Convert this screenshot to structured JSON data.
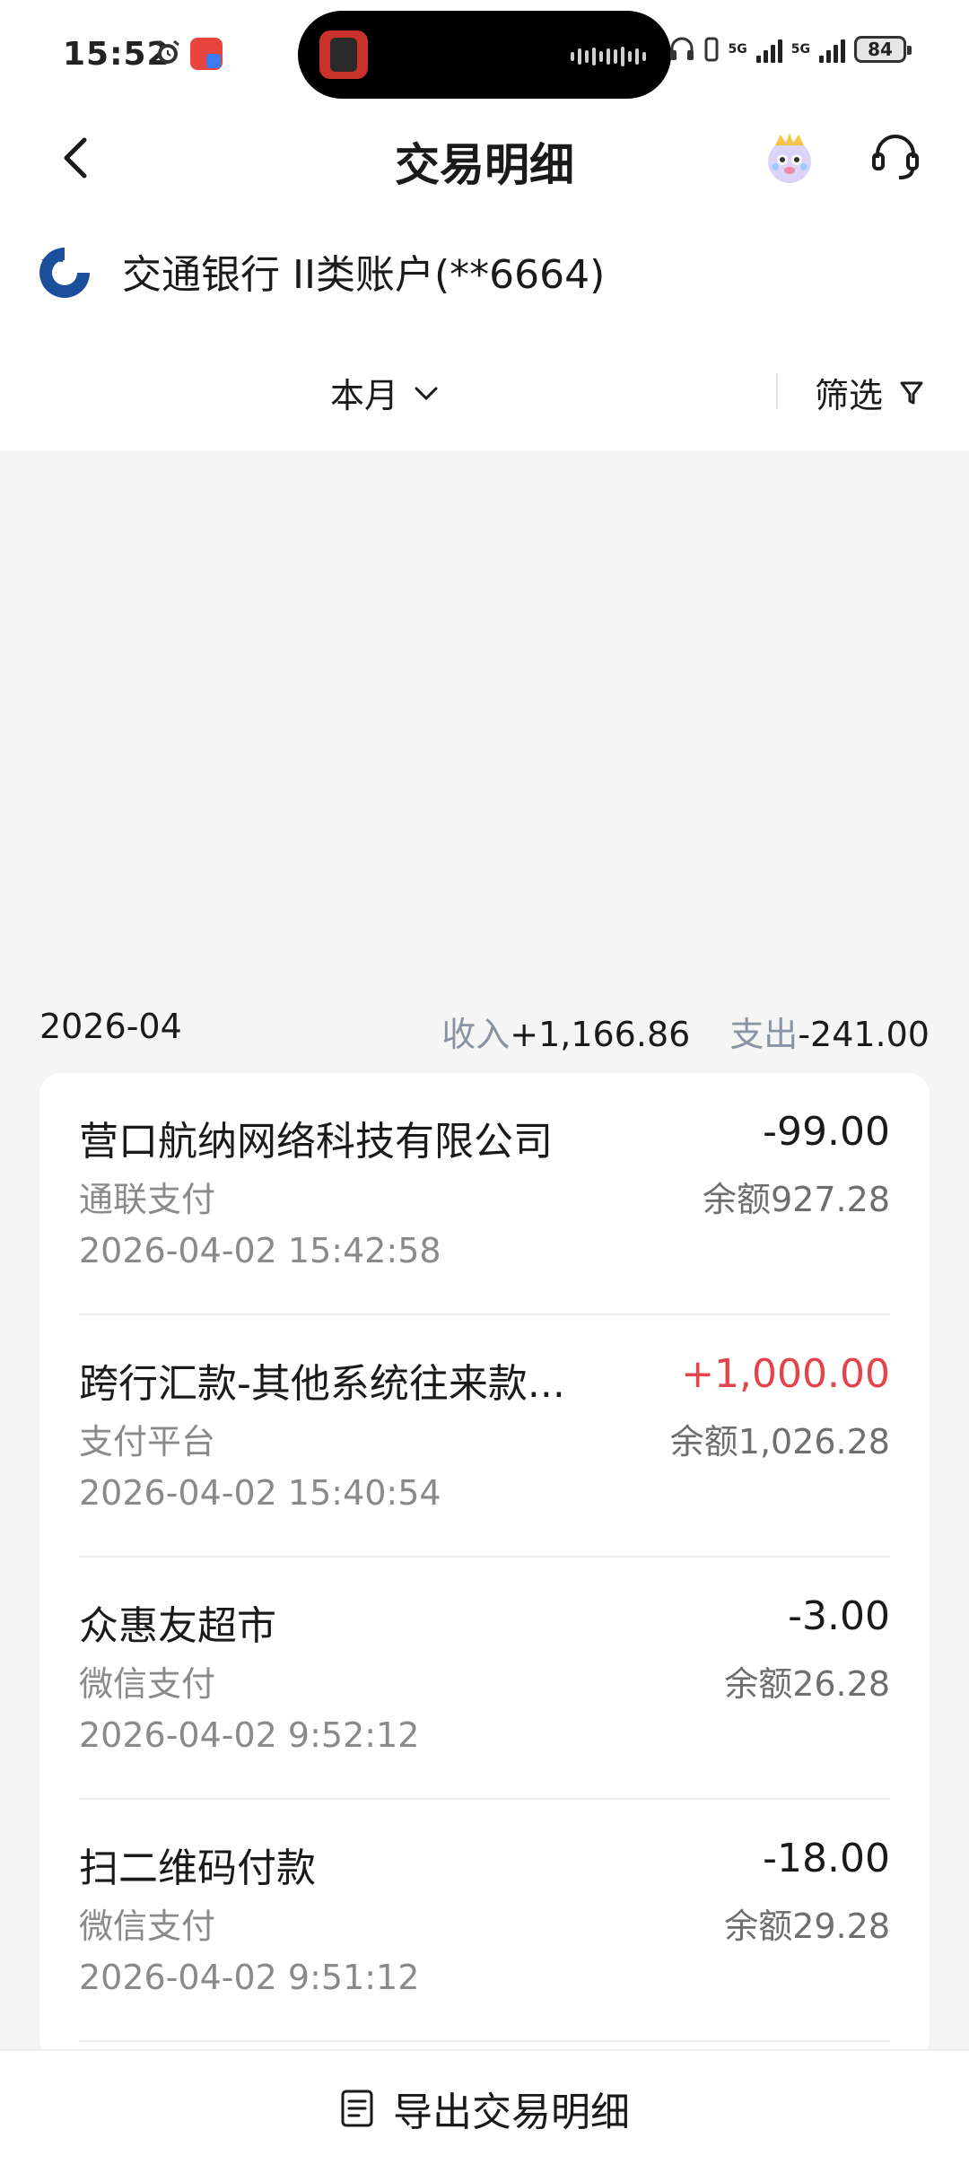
{
  "status_bar": {
    "time": "15:52",
    "signal_1": "5G",
    "signal_2": "5G",
    "battery": "84"
  },
  "header": {
    "title": "交易明细"
  },
  "account": {
    "name": "交通银行 II类账户(**6664)"
  },
  "filter": {
    "period": "本月",
    "filter_label": "筛选"
  },
  "summary": {
    "month": "2026-04",
    "income_label": "收入",
    "income_value": "+1,166.86",
    "expense_label": "支出",
    "expense_value": "-241.00"
  },
  "transactions": [
    {
      "title": "营口航纳网络科技有限公司",
      "amount": "-99.00",
      "channel": "通联支付",
      "balance": "余额927.28",
      "time": "2026-04-02 15:42:58"
    },
    {
      "title": "跨行汇款-其他系统往来款...",
      "amount": "+1,000.00",
      "channel": "支付平台",
      "balance": "余额1,026.28",
      "time": "2026-04-02 15:40:54"
    },
    {
      "title": "众惠友超市",
      "amount": "-3.00",
      "channel": "微信支付",
      "balance": "余额26.28",
      "time": "2026-04-02 9:52:12"
    },
    {
      "title": "扫二维码付款",
      "amount": "-18.00",
      "channel": "微信支付",
      "balance": "余额29.28",
      "time": "2026-04-02 9:51:12"
    }
  ],
  "footer": {
    "export_label": "导出交易明细"
  },
  "colors": {
    "income": "#e5434b",
    "muted": "#8893a3",
    "brand_blue": "#1b4f9c"
  },
  "icons": [
    "back-arrow-icon",
    "mascot-icon",
    "customer-service-icon",
    "bank-logo-icon",
    "chevron-down-icon",
    "filter-funnel-icon",
    "document-icon"
  ]
}
